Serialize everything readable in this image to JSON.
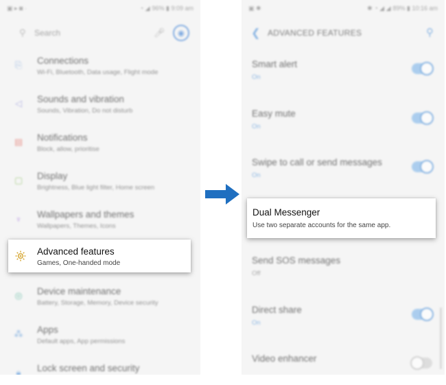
{
  "left": {
    "status": {
      "right_text": "96% ▮ 9:09 am"
    },
    "search": {
      "placeholder": "Search"
    },
    "items": [
      {
        "title": "Connections",
        "subtitle": "Wi-Fi, Bluetooth, Data usage, Flight mode",
        "icon": "connections-icon",
        "color": "#6a9ad8"
      },
      {
        "title": "Sounds and vibration",
        "subtitle": "Sounds, Vibration, Do not disturb",
        "icon": "speaker-icon",
        "color": "#8a8ad8"
      },
      {
        "title": "Notifications",
        "subtitle": "Block, allow, prioritise",
        "icon": "notification-icon",
        "color": "#e0665a"
      },
      {
        "title": "Display",
        "subtitle": "Brightness, Blue light filter, Home screen",
        "icon": "display-icon",
        "color": "#7ab84a"
      },
      {
        "title": "Wallpapers and themes",
        "subtitle": "Wallpapers, Themes, Icons",
        "icon": "brush-icon",
        "color": "#9a6ad8"
      },
      {
        "title": "Advanced features",
        "subtitle": "Games, One-handed mode",
        "icon": "gear-plus-icon",
        "color": "#d4a32a"
      },
      {
        "title": "Device maintenance",
        "subtitle": "Battery, Storage, Memory, Device security",
        "icon": "maintenance-icon",
        "color": "#3aaa8a"
      },
      {
        "title": "Apps",
        "subtitle": "Default apps, App permissions",
        "icon": "apps-icon",
        "color": "#4a8fd8"
      },
      {
        "title": "Lock screen and security",
        "subtitle": "",
        "icon": "lock-icon",
        "color": "#4a8fd8"
      }
    ],
    "highlight": {
      "title": "Advanced features",
      "subtitle": "Games, One-handed mode"
    }
  },
  "right": {
    "status": {
      "right_text": "89% ▮ 10:16 am"
    },
    "header": {
      "title": "ADVANCED FEATURES"
    },
    "items": [
      {
        "title": "Smart alert",
        "subtitle": "On",
        "toggle": true
      },
      {
        "title": "Easy mute",
        "subtitle": "On",
        "toggle": true
      },
      {
        "title": "Swipe to call or send messages",
        "subtitle": "On",
        "toggle": true
      },
      {
        "title": "Dual Messenger",
        "subtitle": "Use two separate accounts for the same app.",
        "toggle": null
      },
      {
        "title": "Send SOS messages",
        "subtitle": "Off",
        "toggle": null
      },
      {
        "title": "Direct share",
        "subtitle": "On",
        "toggle": true
      },
      {
        "title": "Video enhancer",
        "subtitle": "",
        "toggle": false
      }
    ],
    "highlight": {
      "title": "Dual Messenger",
      "subtitle": "Use two separate accounts for the same app."
    }
  },
  "colors": {
    "accent": "#4a8fd8",
    "arrow": "#1f6fc0"
  }
}
